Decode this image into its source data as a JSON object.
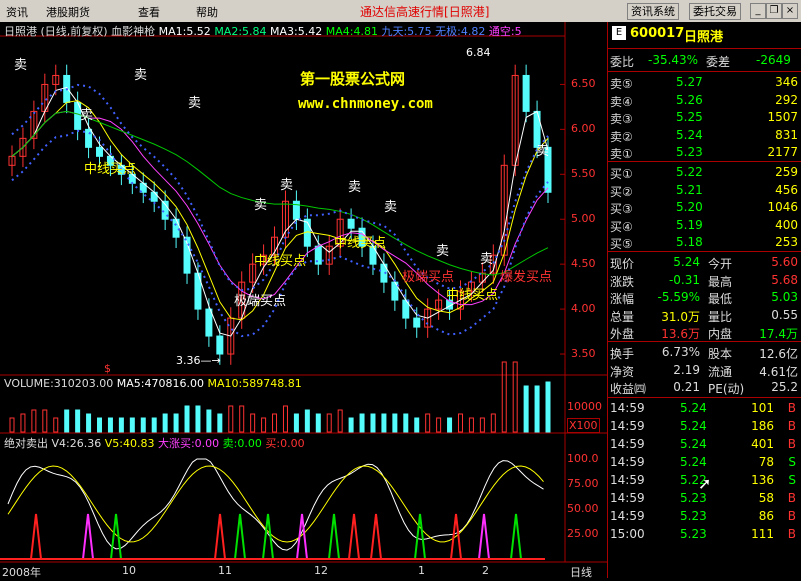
{
  "menu": {
    "items": [
      "资讯",
      "港股期货",
      "查看",
      "帮助"
    ],
    "title": "通达信高速行情",
    "stock_tag": "[日照港]",
    "buttons": [
      "资讯系统",
      "委托交易"
    ]
  },
  "chart_header": {
    "name": "日照港",
    "mode": "(日线,前复权)",
    "indicator": "血影神枪",
    "ma1": "MA1:5.52",
    "ma2": "MA2:5.84",
    "ma3": "MA3:5.42",
    "ma4": "MA4:4.81",
    "jiutian": "九天:5.75",
    "wuji": "无极:4.82",
    "tongkong": "通空:5"
  },
  "watermark": {
    "name": "第一股票公式网",
    "url": "www.chnmoney.com"
  },
  "annotations": {
    "sell": "卖",
    "mid_buy": "中线买点",
    "extreme_buy": "极端买点",
    "burst_buy": "爆发买点",
    "high_label": "6.84",
    "low_label": "3.36",
    "dollar": "$"
  },
  "price_axis": [
    "6.50",
    "6.00",
    "5.50",
    "5.00",
    "4.50",
    "4.00",
    "3.50"
  ],
  "volume_header": {
    "vol": "VOLUME:310203.00",
    "ma5": "MA5:470816.00",
    "ma10": "MA10:589748.81"
  },
  "volume_axis": {
    "top": "10000",
    "unit": "X100"
  },
  "lower_header": {
    "name": "绝对卖出",
    "v4": "V4:26.36",
    "v5": "V5:40.83",
    "big_buy": "大涨买:0.00",
    "sell": "卖:0.00",
    "buy": "买:0.00"
  },
  "lower_axis": [
    "100.0",
    "75.00",
    "50.00",
    "25.00"
  ],
  "time_axis": [
    "2008年",
    "10",
    "11",
    "12",
    "1",
    "2"
  ],
  "period": "日线",
  "colors": {
    "up": "#ff3232",
    "down": "#54fcfc",
    "ma_yellow": "#ffff00",
    "ma_green": "#00c800",
    "dots": "#4060ff"
  },
  "chart_data": {
    "type": "candlestick",
    "price_range": [
      3.3,
      6.95
    ],
    "close_approx": [
      5.7,
      5.9,
      6.2,
      6.5,
      6.6,
      6.3,
      6.0,
      5.8,
      5.7,
      5.6,
      5.5,
      5.4,
      5.3,
      5.2,
      5.0,
      4.8,
      4.4,
      4.0,
      3.7,
      3.5,
      3.9,
      4.3,
      4.5,
      4.6,
      4.8,
      5.2,
      5.0,
      4.7,
      4.5,
      4.7,
      5.0,
      4.9,
      4.7,
      4.5,
      4.3,
      4.1,
      3.9,
      3.8,
      4.0,
      4.1,
      4.0,
      4.2,
      4.3,
      4.4,
      4.6,
      5.6,
      6.6,
      6.2,
      5.8,
      5.3
    ]
  },
  "quote": {
    "code": "600017",
    "name": "日照港",
    "weibi_label": "委比",
    "weibi": "-35.43%",
    "weicha_label": "委差",
    "weicha": "-2649",
    "sells": [
      {
        "label": "卖⑤",
        "price": "5.27",
        "vol": "346"
      },
      {
        "label": "卖④",
        "price": "5.26",
        "vol": "292"
      },
      {
        "label": "卖③",
        "price": "5.25",
        "vol": "1507"
      },
      {
        "label": "卖②",
        "price": "5.24",
        "vol": "831"
      },
      {
        "label": "卖①",
        "price": "5.23",
        "vol": "2177"
      }
    ],
    "buys": [
      {
        "label": "买①",
        "price": "5.22",
        "vol": "259"
      },
      {
        "label": "买②",
        "price": "5.21",
        "vol": "456"
      },
      {
        "label": "买③",
        "price": "5.20",
        "vol": "1046"
      },
      {
        "label": "买④",
        "price": "5.19",
        "vol": "400"
      },
      {
        "label": "买⑤",
        "price": "5.18",
        "vol": "253"
      }
    ],
    "stats": [
      {
        "l1": "现价",
        "v1": "5.24",
        "l2": "今开",
        "v2": "5.60"
      },
      {
        "l1": "涨跌",
        "v1": "-0.31",
        "l2": "最高",
        "v2": "5.68"
      },
      {
        "l1": "涨幅",
        "v1": "-5.59%",
        "l2": "最低",
        "v2": "5.03"
      },
      {
        "l1": "总量",
        "v1": "31.0万",
        "l2": "量比",
        "v2": "0.55"
      },
      {
        "l1": "外盘",
        "v1": "13.6万",
        "l2": "内盘",
        "v2": "17.4万"
      }
    ],
    "fund": [
      {
        "l1": "换手",
        "v1": "6.73%",
        "l2": "股本",
        "v2": "12.6亿"
      },
      {
        "l1": "净资",
        "v1": "2.19",
        "l2": "流通",
        "v2": "4.61亿"
      },
      {
        "l1": "收益㈣",
        "v1": "0.21",
        "l2": "PE(动)",
        "v2": "25.2"
      }
    ],
    "ticks": [
      {
        "t": "14:59",
        "p": "5.24",
        "v": "101",
        "s": "B"
      },
      {
        "t": "14:59",
        "p": "5.24",
        "v": "186",
        "s": "B"
      },
      {
        "t": "14:59",
        "p": "5.24",
        "v": "401",
        "s": "B"
      },
      {
        "t": "14:59",
        "p": "5.24",
        "v": "78",
        "s": "S"
      },
      {
        "t": "14:59",
        "p": "5.22",
        "v": "136",
        "s": "S"
      },
      {
        "t": "14:59",
        "p": "5.23",
        "v": "58",
        "s": "B"
      },
      {
        "t": "14:59",
        "p": "5.23",
        "v": "86",
        "s": "B"
      },
      {
        "t": "15:00",
        "p": "5.23",
        "v": "111",
        "s": "B"
      }
    ]
  }
}
